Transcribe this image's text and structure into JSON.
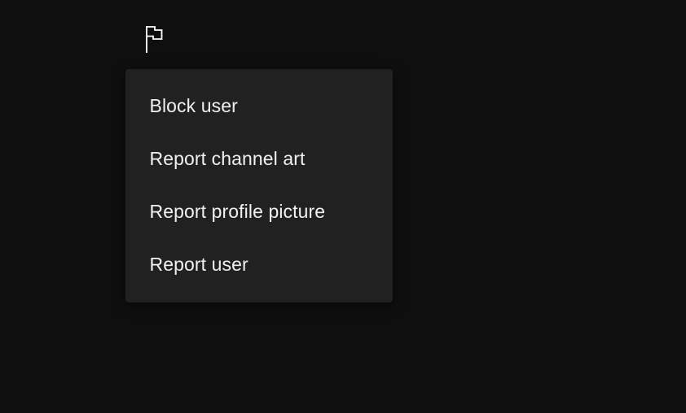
{
  "toolbar": {
    "flag_icon": "flag-icon"
  },
  "menu": {
    "items": [
      {
        "label": "Block user"
      },
      {
        "label": "Report channel art"
      },
      {
        "label": "Report profile picture"
      },
      {
        "label": "Report user"
      }
    ]
  },
  "colors": {
    "background": "#0f0f0f",
    "menu_background": "#212121",
    "text": "#f1f1f1"
  }
}
